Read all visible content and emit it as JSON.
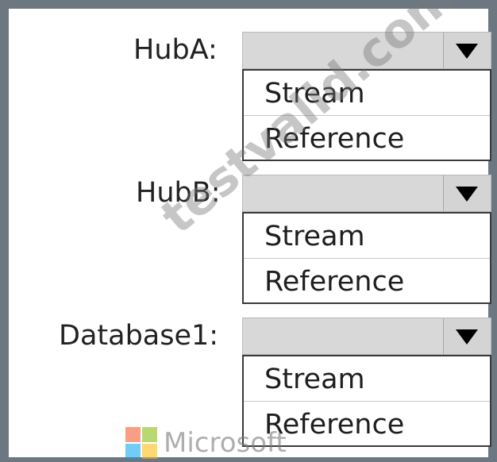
{
  "rows": [
    {
      "label": "HubA:",
      "selected_value": "",
      "options": [
        "Stream",
        "Reference"
      ]
    },
    {
      "label": "HubB:",
      "selected_value": "",
      "options": [
        "Stream",
        "Reference"
      ]
    },
    {
      "label": "Database1:",
      "selected_value": "",
      "options": [
        "Stream",
        "Reference"
      ]
    }
  ],
  "watermark": {
    "text": "testvalid.com"
  },
  "footer_logo": {
    "text": "Microsoft",
    "colors": [
      "#f25022",
      "#7fba00",
      "#00a4ef",
      "#ffb900"
    ]
  },
  "colors": {
    "frame": "#6c7782",
    "dropdown_fill": "#d8d8d8",
    "list_border": "#3a3a3a"
  }
}
